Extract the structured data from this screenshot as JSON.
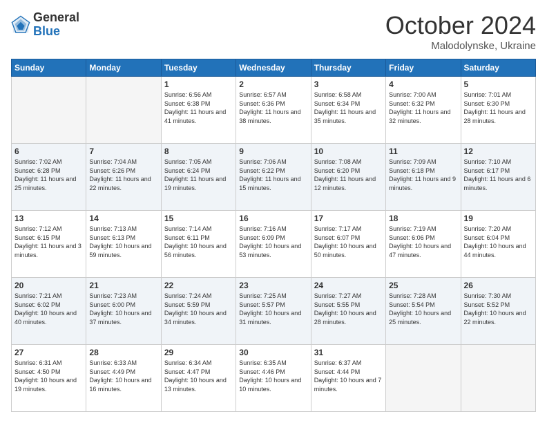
{
  "logo": {
    "general": "General",
    "blue": "Blue"
  },
  "header": {
    "month": "October 2024",
    "location": "Malodolynske, Ukraine"
  },
  "days_of_week": [
    "Sunday",
    "Monday",
    "Tuesday",
    "Wednesday",
    "Thursday",
    "Friday",
    "Saturday"
  ],
  "weeks": [
    [
      {
        "day": "",
        "info": ""
      },
      {
        "day": "",
        "info": ""
      },
      {
        "day": "1",
        "info": "Sunrise: 6:56 AM\nSunset: 6:38 PM\nDaylight: 11 hours and 41 minutes."
      },
      {
        "day": "2",
        "info": "Sunrise: 6:57 AM\nSunset: 6:36 PM\nDaylight: 11 hours and 38 minutes."
      },
      {
        "day": "3",
        "info": "Sunrise: 6:58 AM\nSunset: 6:34 PM\nDaylight: 11 hours and 35 minutes."
      },
      {
        "day": "4",
        "info": "Sunrise: 7:00 AM\nSunset: 6:32 PM\nDaylight: 11 hours and 32 minutes."
      },
      {
        "day": "5",
        "info": "Sunrise: 7:01 AM\nSunset: 6:30 PM\nDaylight: 11 hours and 28 minutes."
      }
    ],
    [
      {
        "day": "6",
        "info": "Sunrise: 7:02 AM\nSunset: 6:28 PM\nDaylight: 11 hours and 25 minutes."
      },
      {
        "day": "7",
        "info": "Sunrise: 7:04 AM\nSunset: 6:26 PM\nDaylight: 11 hours and 22 minutes."
      },
      {
        "day": "8",
        "info": "Sunrise: 7:05 AM\nSunset: 6:24 PM\nDaylight: 11 hours and 19 minutes."
      },
      {
        "day": "9",
        "info": "Sunrise: 7:06 AM\nSunset: 6:22 PM\nDaylight: 11 hours and 15 minutes."
      },
      {
        "day": "10",
        "info": "Sunrise: 7:08 AM\nSunset: 6:20 PM\nDaylight: 11 hours and 12 minutes."
      },
      {
        "day": "11",
        "info": "Sunrise: 7:09 AM\nSunset: 6:18 PM\nDaylight: 11 hours and 9 minutes."
      },
      {
        "day": "12",
        "info": "Sunrise: 7:10 AM\nSunset: 6:17 PM\nDaylight: 11 hours and 6 minutes."
      }
    ],
    [
      {
        "day": "13",
        "info": "Sunrise: 7:12 AM\nSunset: 6:15 PM\nDaylight: 11 hours and 3 minutes."
      },
      {
        "day": "14",
        "info": "Sunrise: 7:13 AM\nSunset: 6:13 PM\nDaylight: 10 hours and 59 minutes."
      },
      {
        "day": "15",
        "info": "Sunrise: 7:14 AM\nSunset: 6:11 PM\nDaylight: 10 hours and 56 minutes."
      },
      {
        "day": "16",
        "info": "Sunrise: 7:16 AM\nSunset: 6:09 PM\nDaylight: 10 hours and 53 minutes."
      },
      {
        "day": "17",
        "info": "Sunrise: 7:17 AM\nSunset: 6:07 PM\nDaylight: 10 hours and 50 minutes."
      },
      {
        "day": "18",
        "info": "Sunrise: 7:19 AM\nSunset: 6:06 PM\nDaylight: 10 hours and 47 minutes."
      },
      {
        "day": "19",
        "info": "Sunrise: 7:20 AM\nSunset: 6:04 PM\nDaylight: 10 hours and 44 minutes."
      }
    ],
    [
      {
        "day": "20",
        "info": "Sunrise: 7:21 AM\nSunset: 6:02 PM\nDaylight: 10 hours and 40 minutes."
      },
      {
        "day": "21",
        "info": "Sunrise: 7:23 AM\nSunset: 6:00 PM\nDaylight: 10 hours and 37 minutes."
      },
      {
        "day": "22",
        "info": "Sunrise: 7:24 AM\nSunset: 5:59 PM\nDaylight: 10 hours and 34 minutes."
      },
      {
        "day": "23",
        "info": "Sunrise: 7:25 AM\nSunset: 5:57 PM\nDaylight: 10 hours and 31 minutes."
      },
      {
        "day": "24",
        "info": "Sunrise: 7:27 AM\nSunset: 5:55 PM\nDaylight: 10 hours and 28 minutes."
      },
      {
        "day": "25",
        "info": "Sunrise: 7:28 AM\nSunset: 5:54 PM\nDaylight: 10 hours and 25 minutes."
      },
      {
        "day": "26",
        "info": "Sunrise: 7:30 AM\nSunset: 5:52 PM\nDaylight: 10 hours and 22 minutes."
      }
    ],
    [
      {
        "day": "27",
        "info": "Sunrise: 6:31 AM\nSunset: 4:50 PM\nDaylight: 10 hours and 19 minutes."
      },
      {
        "day": "28",
        "info": "Sunrise: 6:33 AM\nSunset: 4:49 PM\nDaylight: 10 hours and 16 minutes."
      },
      {
        "day": "29",
        "info": "Sunrise: 6:34 AM\nSunset: 4:47 PM\nDaylight: 10 hours and 13 minutes."
      },
      {
        "day": "30",
        "info": "Sunrise: 6:35 AM\nSunset: 4:46 PM\nDaylight: 10 hours and 10 minutes."
      },
      {
        "day": "31",
        "info": "Sunrise: 6:37 AM\nSunset: 4:44 PM\nDaylight: 10 hours and 7 minutes."
      },
      {
        "day": "",
        "info": ""
      },
      {
        "day": "",
        "info": ""
      }
    ]
  ]
}
